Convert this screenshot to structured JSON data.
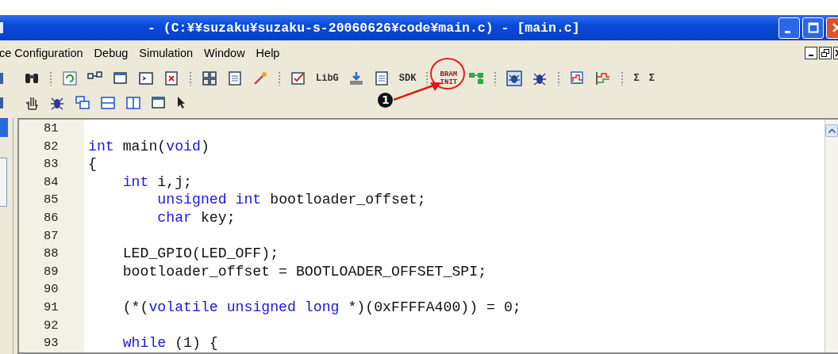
{
  "window": {
    "title": "- (C:¥¥suzaku¥suzaku-s-20060626¥code¥main.c) - [main.c]"
  },
  "menu": [
    "ce Configuration",
    "Debug",
    "Simulation",
    "Window",
    "Help"
  ],
  "toolbars": [
    {
      "items": [
        {
          "kind": "icon"
        },
        {
          "kind": "icon"
        },
        {
          "kind": "grip"
        },
        {
          "kind": "icon"
        },
        {
          "kind": "icon"
        },
        {
          "kind": "icon"
        },
        {
          "kind": "icon"
        },
        {
          "kind": "icon"
        },
        {
          "kind": "grip"
        },
        {
          "kind": "icon"
        },
        {
          "kind": "icon"
        },
        {
          "kind": "icon"
        },
        {
          "kind": "grip"
        },
        {
          "kind": "icon"
        },
        {
          "kind": "label",
          "label": "LibG"
        },
        {
          "kind": "icon"
        },
        {
          "kind": "icon"
        },
        {
          "kind": "label",
          "label": "SDK"
        },
        {
          "kind": "grip"
        },
        {
          "kind": "label",
          "label": "BRAM INIT",
          "annotated": true
        },
        {
          "kind": "icon"
        },
        {
          "kind": "grip"
        },
        {
          "kind": "icon"
        },
        {
          "kind": "icon"
        },
        {
          "kind": "grip"
        },
        {
          "kind": "icon"
        },
        {
          "kind": "icon"
        },
        {
          "kind": "grip"
        },
        {
          "kind": "label",
          "label": "Σ"
        },
        {
          "kind": "label",
          "label": "Σ"
        }
      ]
    },
    {
      "items": [
        {
          "kind": "icon"
        },
        {
          "kind": "icon"
        },
        {
          "kind": "icon"
        },
        {
          "kind": "icon"
        },
        {
          "kind": "icon"
        },
        {
          "kind": "icon"
        },
        {
          "kind": "icon"
        },
        {
          "kind": "icon"
        }
      ]
    }
  ],
  "annotation": {
    "number": "1"
  },
  "editor": {
    "lines": [
      {
        "number": "81"
      },
      {
        "number": "82",
        "tokens": [
          {
            "kind": "keyword",
            "text": "int"
          },
          {
            "kind": "plain",
            "text": " main("
          },
          {
            "kind": "keyword",
            "text": "void"
          },
          {
            "kind": "plain",
            "text": ")"
          }
        ]
      },
      {
        "number": "83",
        "tokens": [
          {
            "kind": "plain",
            "text": "{"
          }
        ]
      },
      {
        "number": "84",
        "tokens": [
          {
            "kind": "keyword",
            "text": "    int"
          },
          {
            "kind": "plain",
            "text": " i,j;"
          }
        ]
      },
      {
        "number": "85",
        "tokens": [
          {
            "kind": "keyword",
            "text": "        unsigned int"
          },
          {
            "kind": "plain",
            "text": " bootloader_offset;"
          }
        ]
      },
      {
        "number": "86",
        "tokens": [
          {
            "kind": "keyword",
            "text": "        char"
          },
          {
            "kind": "plain",
            "text": " key;"
          }
        ]
      },
      {
        "number": "87"
      },
      {
        "number": "88",
        "tokens": [
          {
            "kind": "plain",
            "text": "    LED_GPIO(LED_OFF);"
          }
        ]
      },
      {
        "number": "89",
        "tokens": [
          {
            "kind": "plain",
            "text": "    bootloader_offset = BOOTLOADER_OFFSET_SPI;"
          }
        ]
      },
      {
        "number": "90"
      },
      {
        "number": "91",
        "tokens": [
          {
            "kind": "plain",
            "text": "    (*("
          },
          {
            "kind": "keyword",
            "text": "volatile unsigned long"
          },
          {
            "kind": "plain",
            "text": " *)(0xFFFFA400)) = 0;"
          }
        ]
      },
      {
        "number": "92"
      },
      {
        "number": "93",
        "tokens": [
          {
            "kind": "keyword",
            "text": "    while"
          },
          {
            "kind": "plain",
            "text": " (1) {"
          }
        ]
      }
    ]
  }
}
